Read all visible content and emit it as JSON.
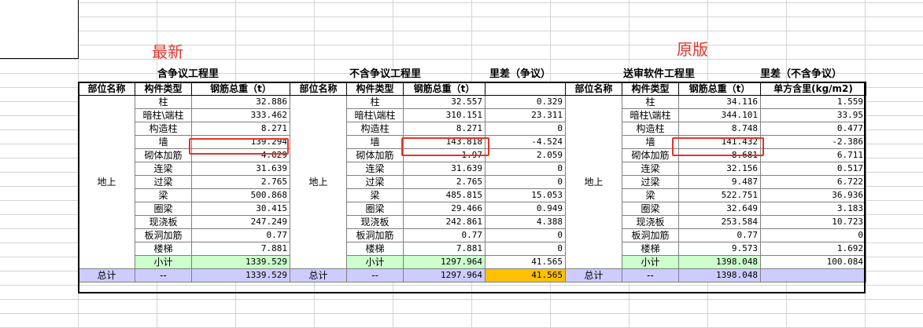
{
  "labels": {
    "latest": "最新",
    "original": "原版"
  },
  "sections": {
    "with_dispute": "含争议工程里",
    "without_dispute": "不含争议工程里",
    "diff_dispute": "里差（争议）",
    "submitted": "送审软件工程里",
    "diff_no_dispute": "里差（不含争议）"
  },
  "headers": {
    "part": "部位名称",
    "type": "构件类型",
    "weight": "钢筋总重（t）",
    "unit_content": "单方含里(kg/m2)"
  },
  "area_label": "地上",
  "rows": [
    {
      "type": "柱",
      "a": "32.886",
      "b": "32.557",
      "d1": "0.329",
      "c": "34.116",
      "d2": "1.559"
    },
    {
      "type": "暗柱\\端柱",
      "a": "333.462",
      "b": "310.151",
      "d1": "23.311",
      "c": "344.101",
      "d2": "33.95"
    },
    {
      "type": "构造柱",
      "a": "8.271",
      "b": "8.271",
      "d1": "0",
      "c": "8.748",
      "d2": "0.477"
    },
    {
      "type": "墙",
      "a": "139.294",
      "b": "143.818",
      "d1": "-4.524",
      "c": "141.432",
      "d2": "-2.386"
    },
    {
      "type": "砌体加筋",
      "a": "4.029",
      "b": "1.97",
      "d1": "2.059",
      "c": "8.681",
      "d2": "6.711"
    },
    {
      "type": "连梁",
      "a": "31.639",
      "b": "31.639",
      "d1": "0",
      "c": "32.156",
      "d2": "0.517"
    },
    {
      "type": "过梁",
      "a": "2.765",
      "b": "2.765",
      "d1": "0",
      "c": "9.487",
      "d2": "6.722"
    },
    {
      "type": "梁",
      "a": "500.868",
      "b": "485.815",
      "d1": "15.053",
      "c": "522.751",
      "d2": "36.936"
    },
    {
      "type": "圈梁",
      "a": "30.415",
      "b": "29.466",
      "d1": "0.949",
      "c": "32.649",
      "d2": "3.183"
    },
    {
      "type": "现浇板",
      "a": "247.249",
      "b": "242.861",
      "d1": "4.388",
      "c": "253.584",
      "d2": "10.723"
    },
    {
      "type": "板洞加筋",
      "a": "0.77",
      "b": "0.77",
      "d1": "0",
      "c": "0.77",
      "d2": "0"
    },
    {
      "type": "楼梯",
      "a": "7.881",
      "b": "7.881",
      "d1": "0",
      "c": "9.573",
      "d2": "1.692"
    }
  ],
  "subtotal": {
    "label": "小计",
    "a": "1339.529",
    "b": "1297.964",
    "d1": "41.565",
    "c": "1398.048",
    "d2": "100.084"
  },
  "total": {
    "label": "总计",
    "dash": "--",
    "a": "1339.529",
    "b": "1297.964",
    "d1": "41.565",
    "c": "1398.048"
  },
  "colors": {
    "highlight_red": "#e0352b",
    "subtotal_green": "#ccffcc",
    "total_blue": "#ccccff",
    "total_orange": "#ffc000"
  }
}
